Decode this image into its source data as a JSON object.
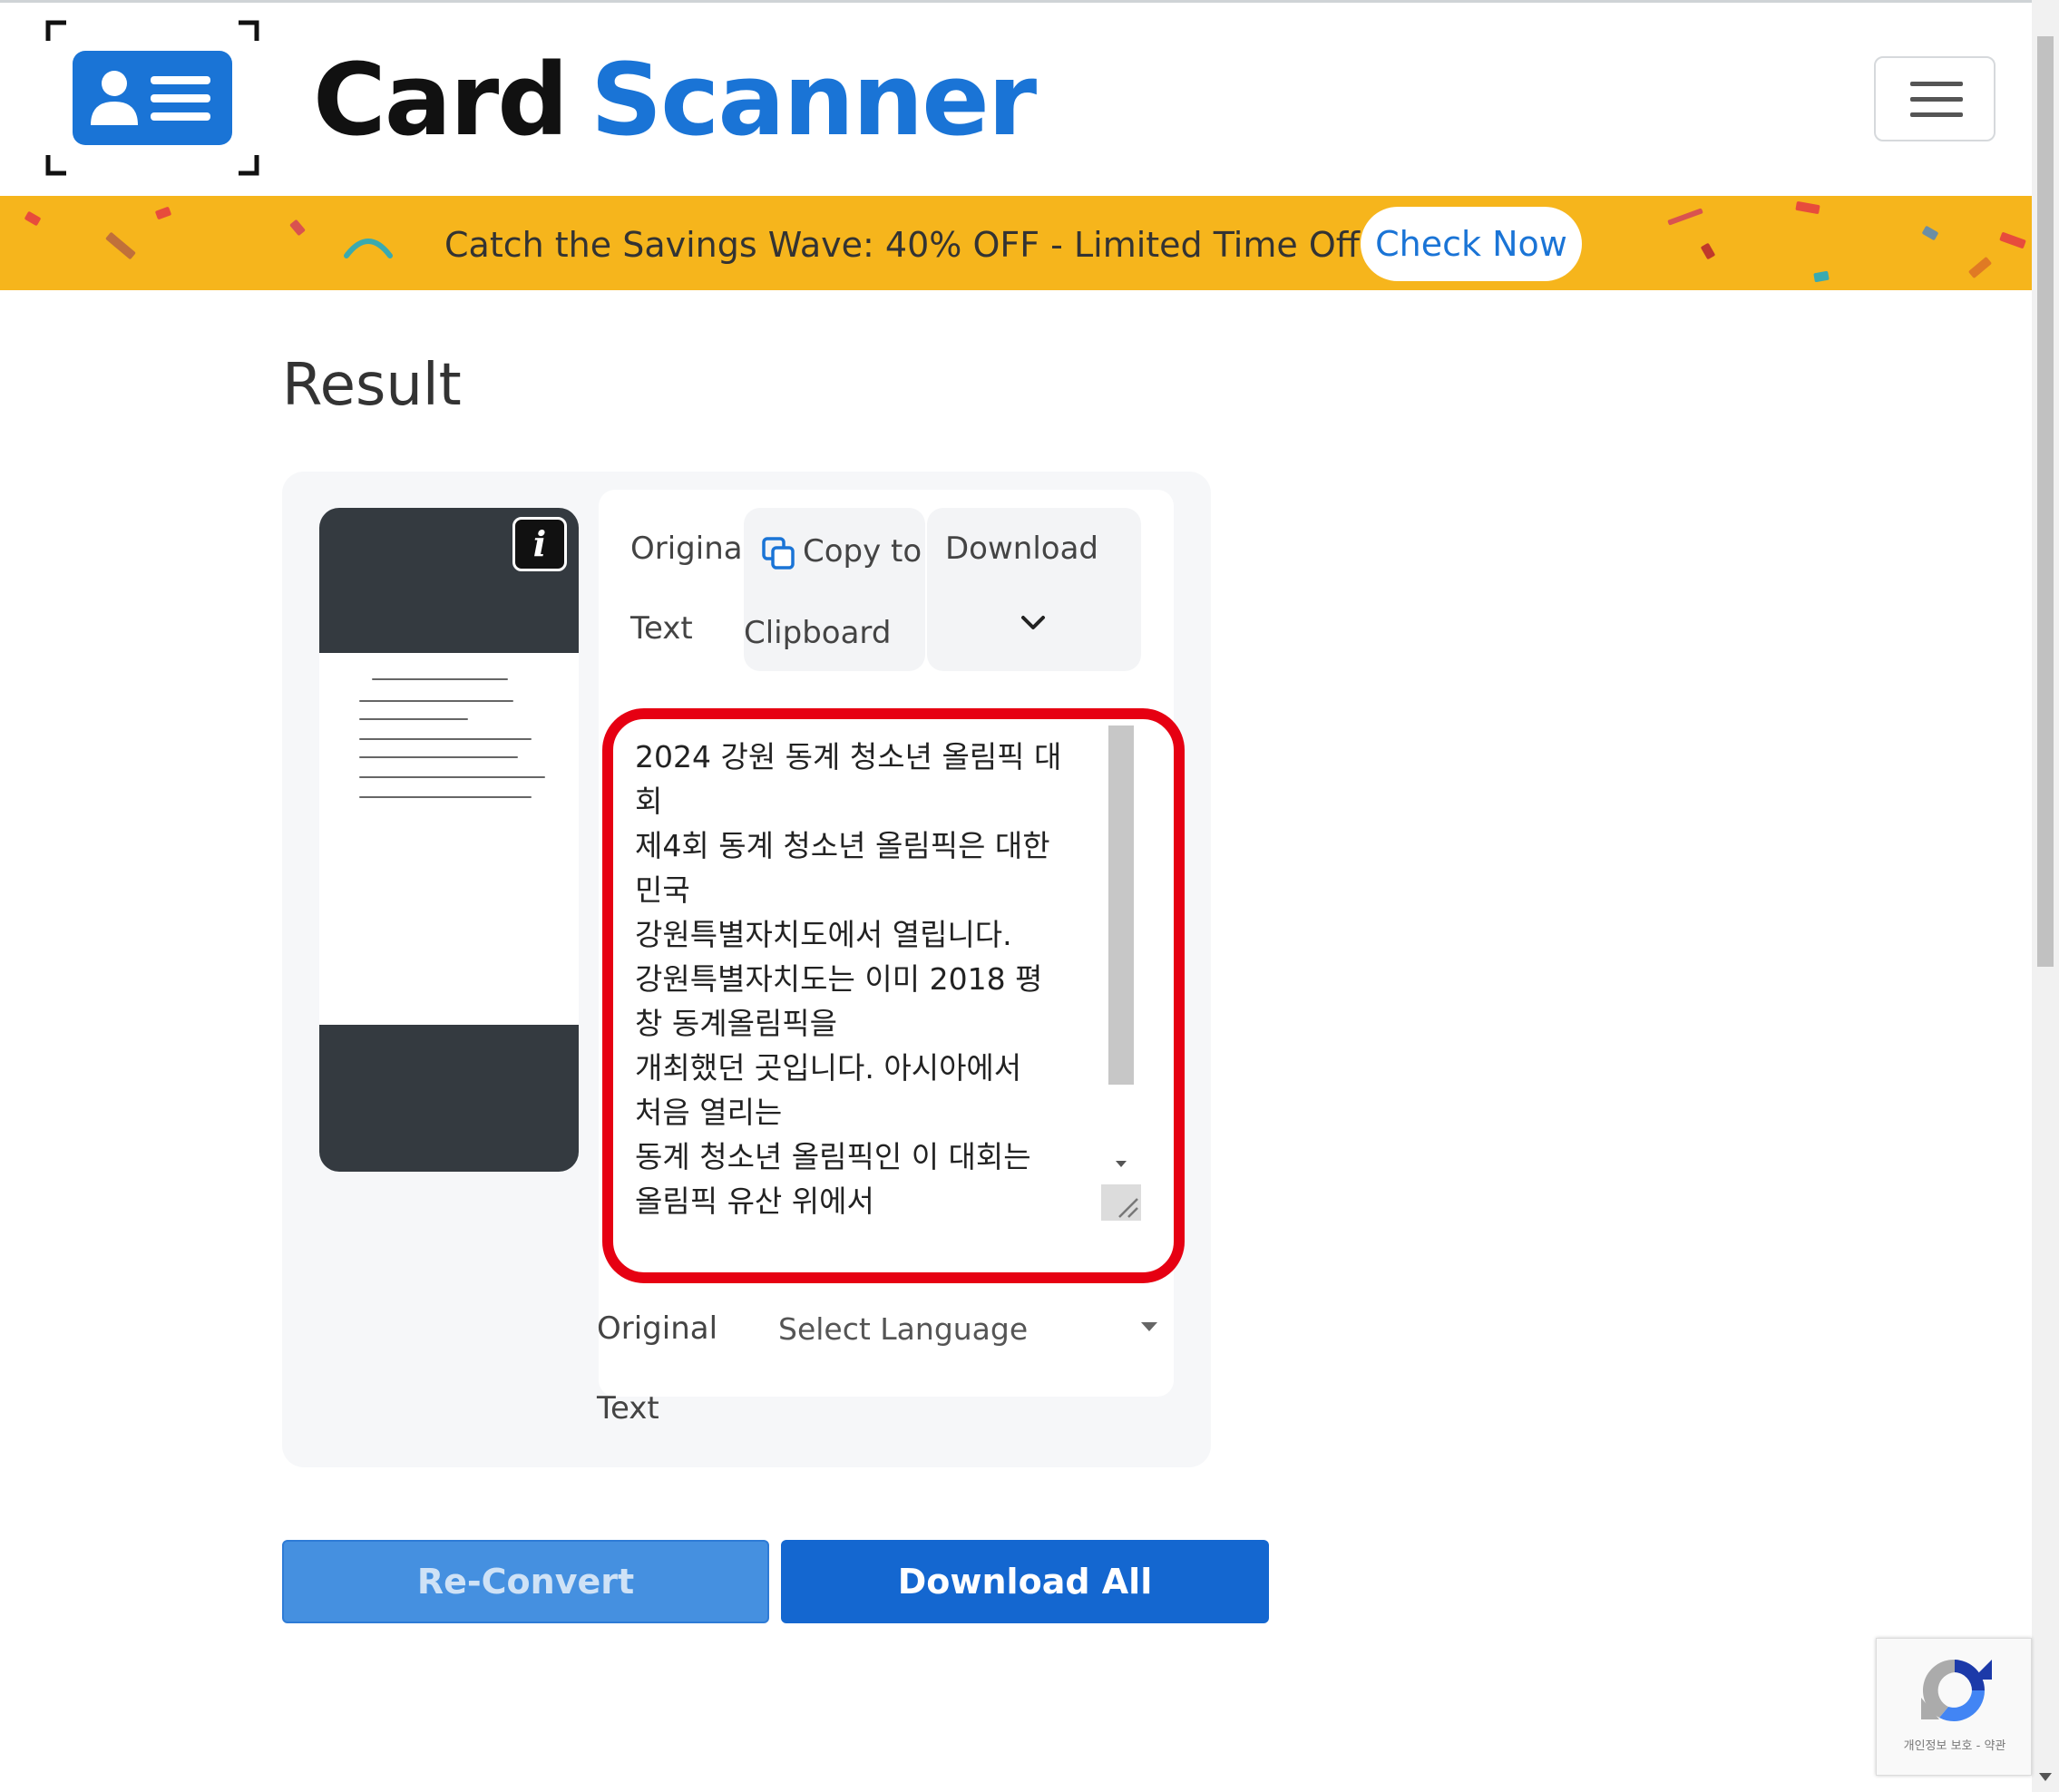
{
  "header": {
    "brand_part1": "Card",
    "brand_part2": "Scanner",
    "logo_icon": "id-card-scan-icon",
    "menu_icon": "hamburger-menu-icon"
  },
  "promo": {
    "text": "Catch the Savings Wave: 40% OFF - Limited Time Offer",
    "cta": "Check Now"
  },
  "result": {
    "title": "Result",
    "tabs": {
      "original_text_line1": "Original",
      "original_text_line2": "Text",
      "copy_line1": "Copy to",
      "copy_line2": "Clipboard",
      "download": "Download"
    },
    "extracted_text": "2024 강원 동계 청소년 올림픽 대\n회\n제4회 동계 청소년 올림픽은 대한\n민국\n강원특별자치도에서 열립니다.\n강원특별자치도는 이미 2018 평\n창 동계올림픽을\n개최했던 곳입니다. 아시아에서\n처음 열리는\n동계 청소년 올림픽인 이 대회는\n올림픽 유산 위에서",
    "translate_label_line1": "Original",
    "translate_label_line2": "Text",
    "language_select_placeholder": "Select Language"
  },
  "actions": {
    "reconvert": "Re-Convert",
    "download_all": "Download All"
  },
  "recaptcha": {
    "footer_text": "개인정보 보호 - 약관"
  },
  "colors": {
    "brand_blue": "#1a74d6",
    "promo_bg": "#f6b51c",
    "highlight_red": "#e60012",
    "primary_button": "#1467d0"
  }
}
